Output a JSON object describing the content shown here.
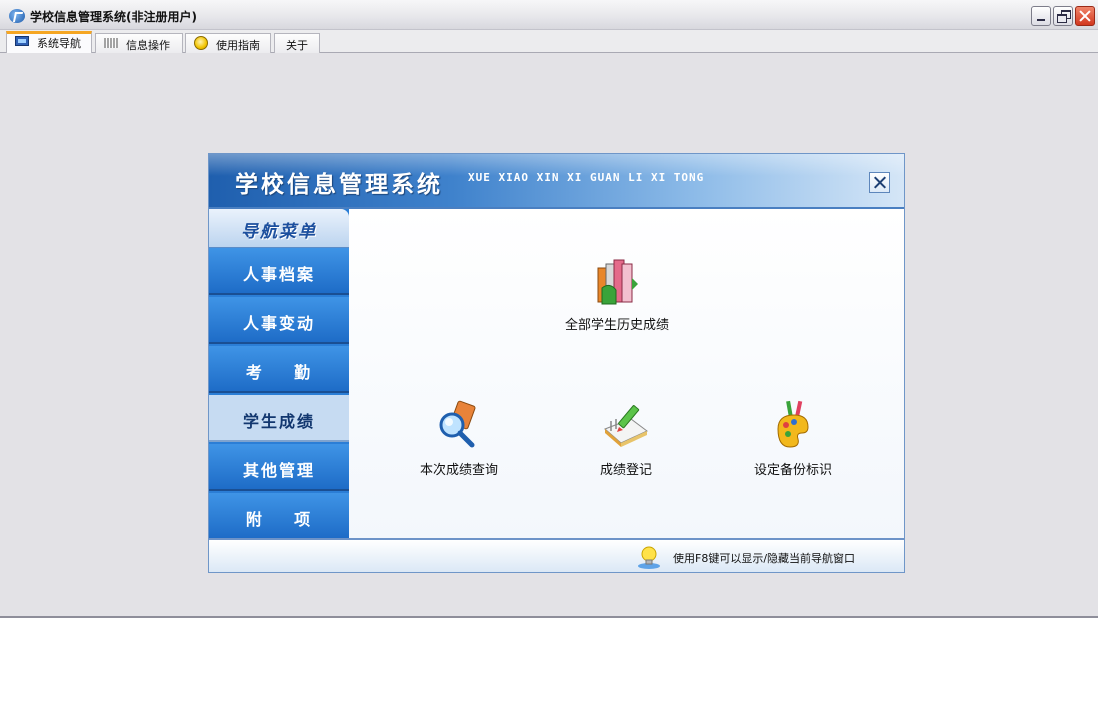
{
  "window": {
    "title": "学校信息管理系统(非注册用户)",
    "controls": [
      "minimize-icon",
      "restore-icon",
      "close-icon"
    ]
  },
  "tabs": [
    {
      "label": "系统导航",
      "icon": "monitor-icon",
      "active": true
    },
    {
      "label": "信息操作",
      "icon": "grid-icon",
      "active": false
    },
    {
      "label": "使用指南",
      "icon": "help-icon",
      "active": false
    },
    {
      "label": "关于",
      "icon": "",
      "active": false
    }
  ],
  "dialog": {
    "title": "学校信息管理系统",
    "subtitle": "XUE XIAO XIN XI GUAN LI XI TONG",
    "close_icon": "close-icon"
  },
  "nav": {
    "header": "导航菜单",
    "items": [
      {
        "label": "人事档案",
        "selected": false
      },
      {
        "label": "人事变动",
        "selected": false
      },
      {
        "label": "考    勤",
        "selected": false
      },
      {
        "label": "学生成绩",
        "selected": true
      },
      {
        "label": "其他管理",
        "selected": false
      },
      {
        "label": "附    项",
        "selected": false
      }
    ]
  },
  "features": [
    {
      "label": "全部学生历史成绩",
      "icon": "books-icon"
    },
    {
      "label": "本次成绩查询",
      "icon": "magnifier-icon"
    },
    {
      "label": "成绩登记",
      "icon": "notebook-pencil-icon"
    },
    {
      "label": "设定备份标识",
      "icon": "palette-icon"
    }
  ],
  "status": {
    "icon": "lightbulb-icon",
    "text": "使用F8键可以显示/隐藏当前导航窗口"
  },
  "colors": {
    "accent": "#2b7ed6",
    "header_gradient_start": "#1f5fae",
    "tab_active_marker": "#f5a623",
    "window_bg": "#e3e2e6"
  }
}
